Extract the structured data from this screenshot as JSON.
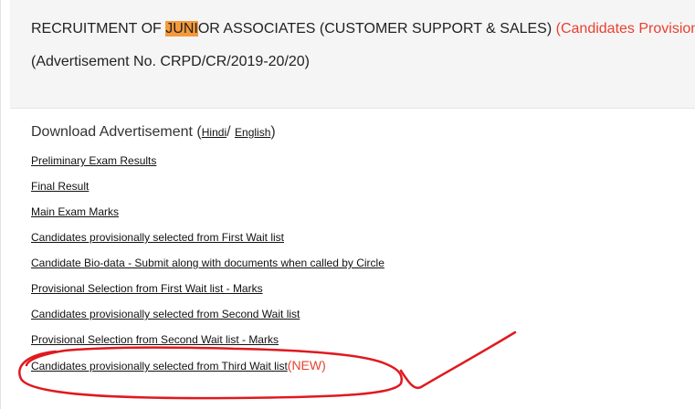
{
  "header": {
    "title_prefix": "RECRUITMENT OF ",
    "title_highlight": "JUNI",
    "title_suffix": "OR ASSOCIATES (CUSTOMER SUPPORT & SALES)",
    "title_status": "(Candidates Provision",
    "advertisement_no": "(Advertisement No. CRPD/CR/2019-20/20)"
  },
  "download": {
    "label": "Download Advertisement (",
    "hindi": "Hindi",
    "separator": "/ ",
    "english": "English",
    "close": ")"
  },
  "links": [
    {
      "label": "Preliminary Exam Results"
    },
    {
      "label": "Final Result"
    },
    {
      "label": "Main Exam Marks"
    },
    {
      "label": "Candidates provisionally selected from First Wait list"
    },
    {
      "label": "Candidate Bio-data - Submit along with documents when called by Circle"
    },
    {
      "label": "Provisional Selection from First Wait list - Marks"
    },
    {
      "label": "Candidates provisionally selected from Second Wait list"
    },
    {
      "label": "Provisional Selection from Second Wait list - Marks"
    },
    {
      "label": "Candidates provisionally selected from Third Wait list",
      "badge": "(NEW)"
    }
  ],
  "colors": {
    "highlight": "#f59a3c",
    "status_red": "#e8412f",
    "annotation_red": "#e0191e"
  }
}
